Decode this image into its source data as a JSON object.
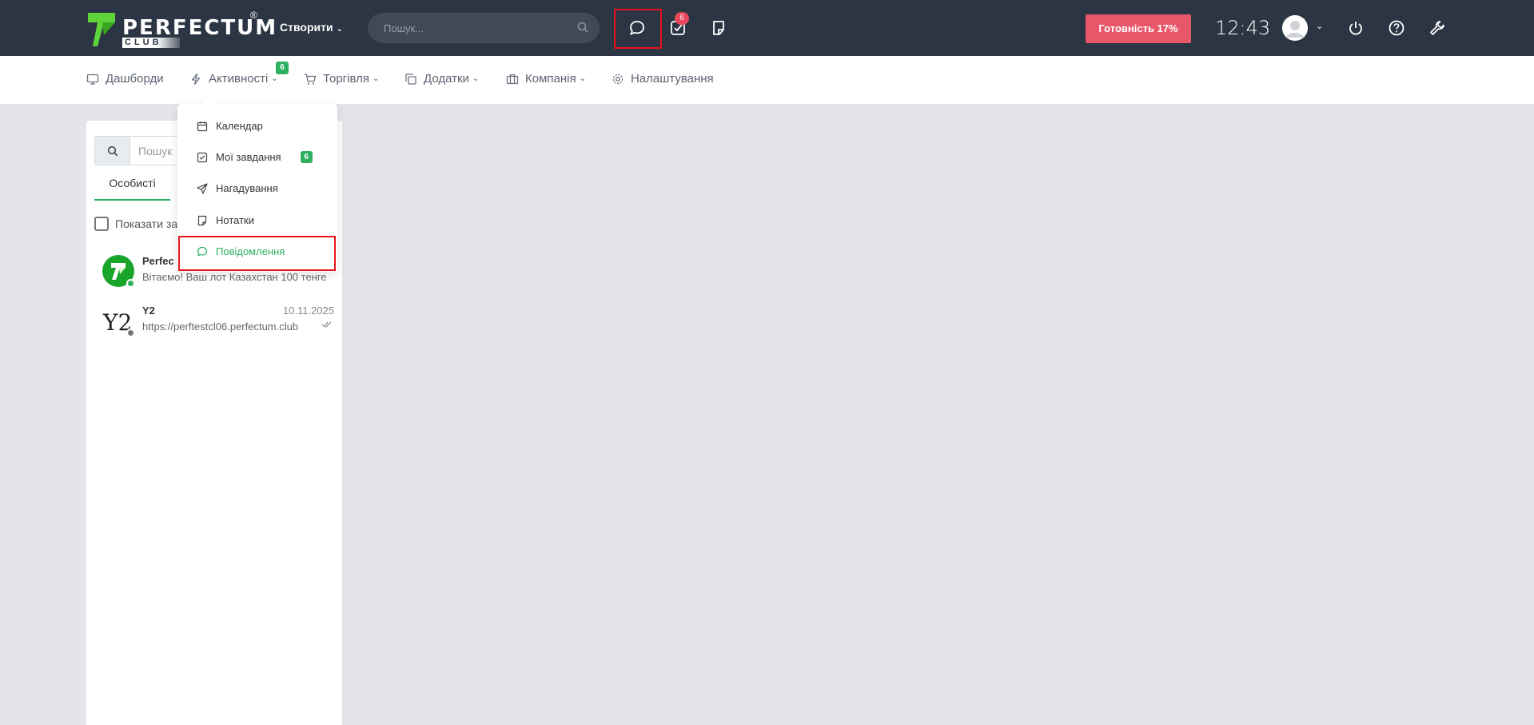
{
  "app": {
    "brand": "PERFECTUM",
    "brand_sub": "CLUB",
    "brand_reg": "®"
  },
  "topbar": {
    "create_label": "Створити",
    "search_placeholder": "Пошук...",
    "tasks_badge": "6",
    "readiness_label": "Готовність 17%",
    "clock": "12:43"
  },
  "nav": {
    "items": [
      {
        "label": "Дашборди",
        "icon": "monitor-icon"
      },
      {
        "label": "Активності",
        "icon": "lightning-icon",
        "badge": "6"
      },
      {
        "label": "Торгівля",
        "icon": "cart-icon"
      },
      {
        "label": "Додатки",
        "icon": "copy-icon"
      },
      {
        "label": "Компанія",
        "icon": "briefcase-icon"
      },
      {
        "label": "Налаштування",
        "icon": "gear-icon"
      }
    ]
  },
  "dropdown": {
    "items": [
      {
        "label": "Календар",
        "icon": "calendar-icon"
      },
      {
        "label": "Мої завдання",
        "icon": "checkbox-icon",
        "badge": "6"
      },
      {
        "label": "Нагадування",
        "icon": "send-icon"
      },
      {
        "label": "Нотатки",
        "icon": "note-icon"
      },
      {
        "label": "Повідомлення",
        "icon": "chat-icon",
        "active": true
      }
    ]
  },
  "panel": {
    "search_placeholder": "Пошук",
    "tab_personal": "Особисті",
    "show_label": "Показати за",
    "chats": [
      {
        "name": "Perfec",
        "message": "Вітаємо! Ваш лот Казахстан 100 тенге",
        "date": "",
        "status": "online"
      },
      {
        "name": "Y2",
        "message": "https://perftestcl06.perfectum.club",
        "date": "10.11.2025",
        "status": "offline"
      }
    ]
  },
  "colors": {
    "topbar_bg": "#2b3543",
    "accent_green": "#2eb061",
    "ready_bg": "#e8566a",
    "highlight": "#e8121a"
  }
}
